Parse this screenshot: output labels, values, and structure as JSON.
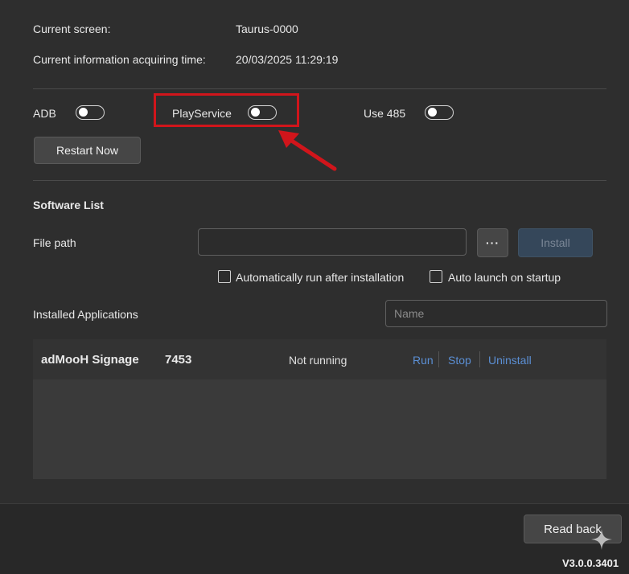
{
  "info": {
    "current_screen_label": "Current screen:",
    "current_screen_value": "Taurus-0000",
    "acquire_time_label": "Current information acquiring time:",
    "acquire_time_value": "20/03/2025 11:29:19"
  },
  "switches": {
    "adb_label": "ADB",
    "play_service_label": "PlayService",
    "use485_label": "Use 485",
    "adb_on": false,
    "play_service_on": false,
    "use485_on": false
  },
  "restart_label": "Restart Now",
  "software": {
    "title": "Software List",
    "file_path_label": "File path",
    "file_path_value": "",
    "browse_label": "···",
    "install_label": "Install",
    "auto_run_label": "Automatically run after installation",
    "auto_launch_label": "Auto launch on startup",
    "installed_label": "Installed Applications",
    "name_placeholder": "Name"
  },
  "apps": [
    {
      "name": "adMooH Signage",
      "version": "7453",
      "status": "Not running",
      "run": "Run",
      "stop": "Stop",
      "uninstall": "Uninstall"
    }
  ],
  "footer": {
    "read_back_label": "Read back",
    "version": "V3.0.0.3401"
  },
  "colors": {
    "background": "#2e2e2e",
    "highlight": "#d1151b",
    "link": "#5b8fd4"
  }
}
